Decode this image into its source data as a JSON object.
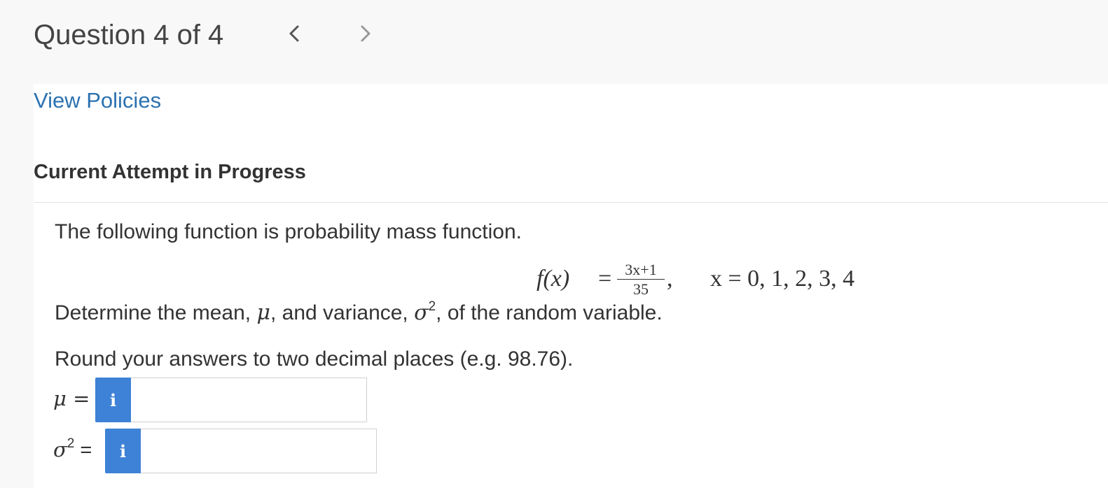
{
  "header": {
    "question_title": "Question 4 of 4",
    "prev_icon": "chevron-left-icon",
    "next_icon": "chevron-right-icon"
  },
  "links": {
    "view_policies": "View Policies"
  },
  "attempt": {
    "heading": "Current Attempt in Progress"
  },
  "question": {
    "intro": "The following function is probability mass function.",
    "formula": {
      "lhs": "f(x)",
      "equals": "=",
      "numerator": "3x+1",
      "denominator": "35",
      "comma": ",",
      "domain": "x = 0, 1, 2, 3, 4"
    },
    "instruction_part1": "Determine the mean, ",
    "mu_symbol": "μ",
    "instruction_part2": ", and variance, ",
    "sigma_symbol": "σ",
    "sigma_exp": "2",
    "instruction_part3": ", of the random variable.",
    "rounding": "Round your answers to two decimal places (e.g. 98.76)."
  },
  "answers": {
    "mu_label": "μ =",
    "var_label_base": "σ",
    "var_label_exp": "2",
    "var_label_eq": " =",
    "info_glyph": "i",
    "info_icon": "info-icon",
    "mu_value": "",
    "var_value": ""
  },
  "colors": {
    "accent": "#3d82d6",
    "link": "#2b72b0",
    "header_bg": "#f8f8f8"
  }
}
